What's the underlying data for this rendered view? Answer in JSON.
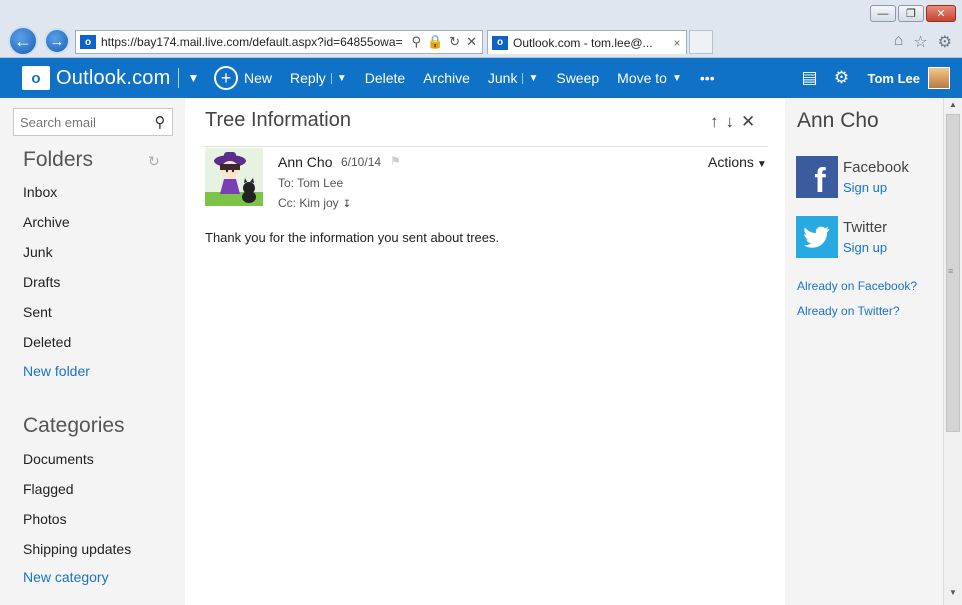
{
  "browser": {
    "address_url": "https://bay174.mail.live.com/default.aspx?id=64855owa=",
    "tab_title": "Outlook.com - tom.lee@...",
    "tab_close": "×",
    "favicon": "o",
    "icons": [
      "home-icon",
      "star-icon",
      "gear-icon"
    ]
  },
  "topbar": {
    "brand_logo": "o",
    "brand_name": "Outlook.com",
    "new_label": "New",
    "reply_label": "Reply",
    "delete_label": "Delete",
    "archive_label": "Archive",
    "junk_label": "Junk",
    "sweep_label": "Sweep",
    "moveto_label": "Move to",
    "more_label": "•••",
    "user_name": "Tom Lee",
    "accent_color": "#0f72c6"
  },
  "leftnav": {
    "search_placeholder": "Search email",
    "folders_heading": "Folders",
    "folders": [
      "Inbox",
      "Archive",
      "Junk",
      "Drafts",
      "Sent",
      "Deleted"
    ],
    "new_folder": "New folder",
    "categories_heading": "Categories",
    "categories": [
      "Documents",
      "Flagged",
      "Photos",
      "Shipping updates"
    ],
    "new_category": "New category"
  },
  "message": {
    "subject": "Tree Information",
    "sender_name": "Ann Cho",
    "date": "6/10/14",
    "to": "To: Tom Lee",
    "cc": "Cc: Kim joy",
    "actions_label": "Actions",
    "body": "Thank you for the information you sent about trees."
  },
  "people": {
    "name": "Ann Cho",
    "facebook_label": "Facebook",
    "facebook_signup": "Sign up",
    "twitter_label": "Twitter",
    "twitter_signup": "Sign up",
    "already_facebook": "Already on Facebook?",
    "already_twitter": "Already on Twitter?"
  }
}
